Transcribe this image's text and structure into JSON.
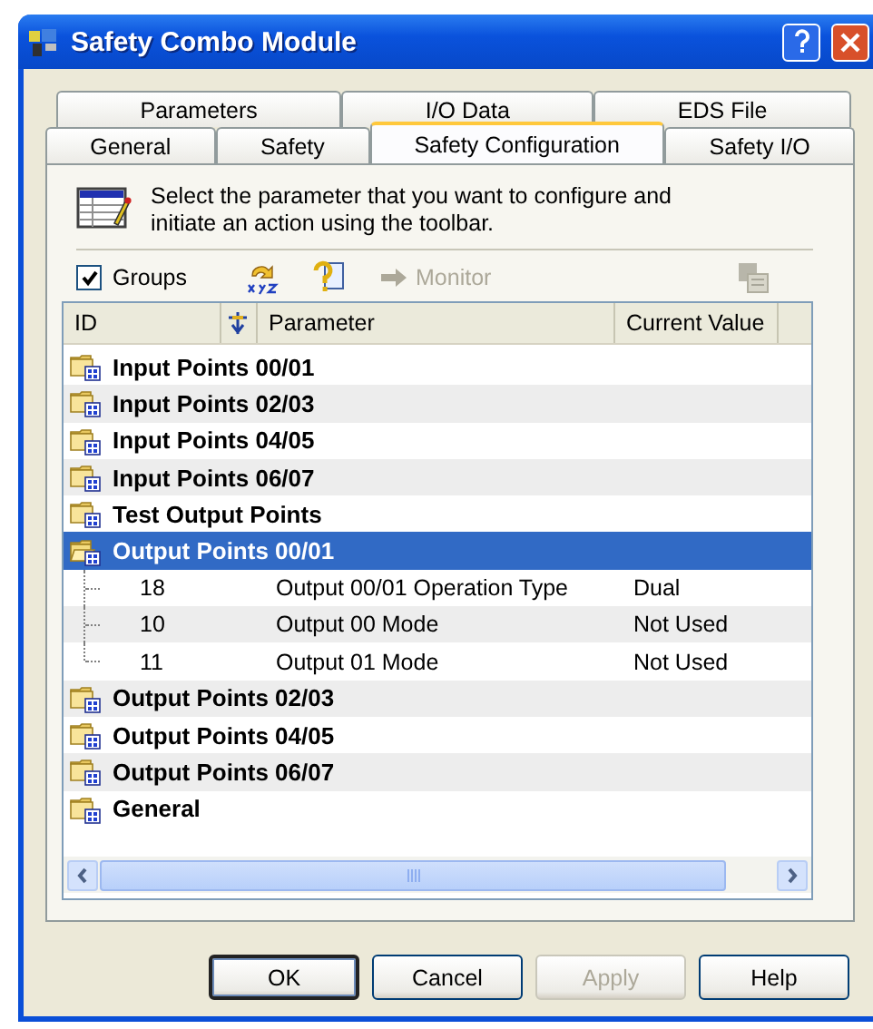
{
  "window": {
    "title": "Safety Combo Module"
  },
  "tab_rows": [
    [
      {
        "label": "Parameters",
        "selected": false
      },
      {
        "label": "I/O Data",
        "selected": false
      },
      {
        "label": "EDS File",
        "selected": false
      }
    ],
    [
      {
        "label": "General",
        "selected": false
      },
      {
        "label": "Safety",
        "selected": false
      },
      {
        "label": "Safety Configuration",
        "selected": true
      },
      {
        "label": "Safety I/O",
        "selected": false
      }
    ]
  ],
  "instructions": "Select the parameter that you want to configure and initiate an action using the toolbar.",
  "toolbar": {
    "groups": {
      "label": "Groups",
      "checked": true
    },
    "monitor": {
      "label": "Monitor",
      "disabled": true
    }
  },
  "tree": {
    "columns": [
      "ID",
      "Parameter",
      "Current Value"
    ],
    "items": [
      {
        "label": "Input Points 00/01",
        "selected": false,
        "expanded": false
      },
      {
        "label": "Input Points 02/03",
        "selected": false,
        "expanded": false
      },
      {
        "label": "Input Points 04/05",
        "selected": false,
        "expanded": false
      },
      {
        "label": "Input Points 06/07",
        "selected": false,
        "expanded": false
      },
      {
        "label": "Test Output Points",
        "selected": false,
        "expanded": false
      },
      {
        "label": "Output Points 00/01",
        "selected": true,
        "expanded": true,
        "children": [
          {
            "id": "18",
            "parameter": "Output 00/01 Operation Type",
            "value": "Dual"
          },
          {
            "id": "10",
            "parameter": "Output 00 Mode",
            "value": "Not Used"
          },
          {
            "id": "11",
            "parameter": "Output 01 Mode",
            "value": "Not Used"
          }
        ]
      },
      {
        "label": "Output Points 02/03",
        "selected": false,
        "expanded": false
      },
      {
        "label": "Output Points 04/05",
        "selected": false,
        "expanded": false
      },
      {
        "label": "Output Points 06/07",
        "selected": false,
        "expanded": false
      },
      {
        "label": "General",
        "selected": false,
        "expanded": false
      }
    ]
  },
  "buttons": [
    {
      "label": "OK",
      "default": true,
      "disabled": false
    },
    {
      "label": "Cancel",
      "default": false,
      "disabled": false
    },
    {
      "label": "Apply",
      "default": false,
      "disabled": true
    },
    {
      "label": "Help",
      "default": false,
      "disabled": false
    }
  ]
}
